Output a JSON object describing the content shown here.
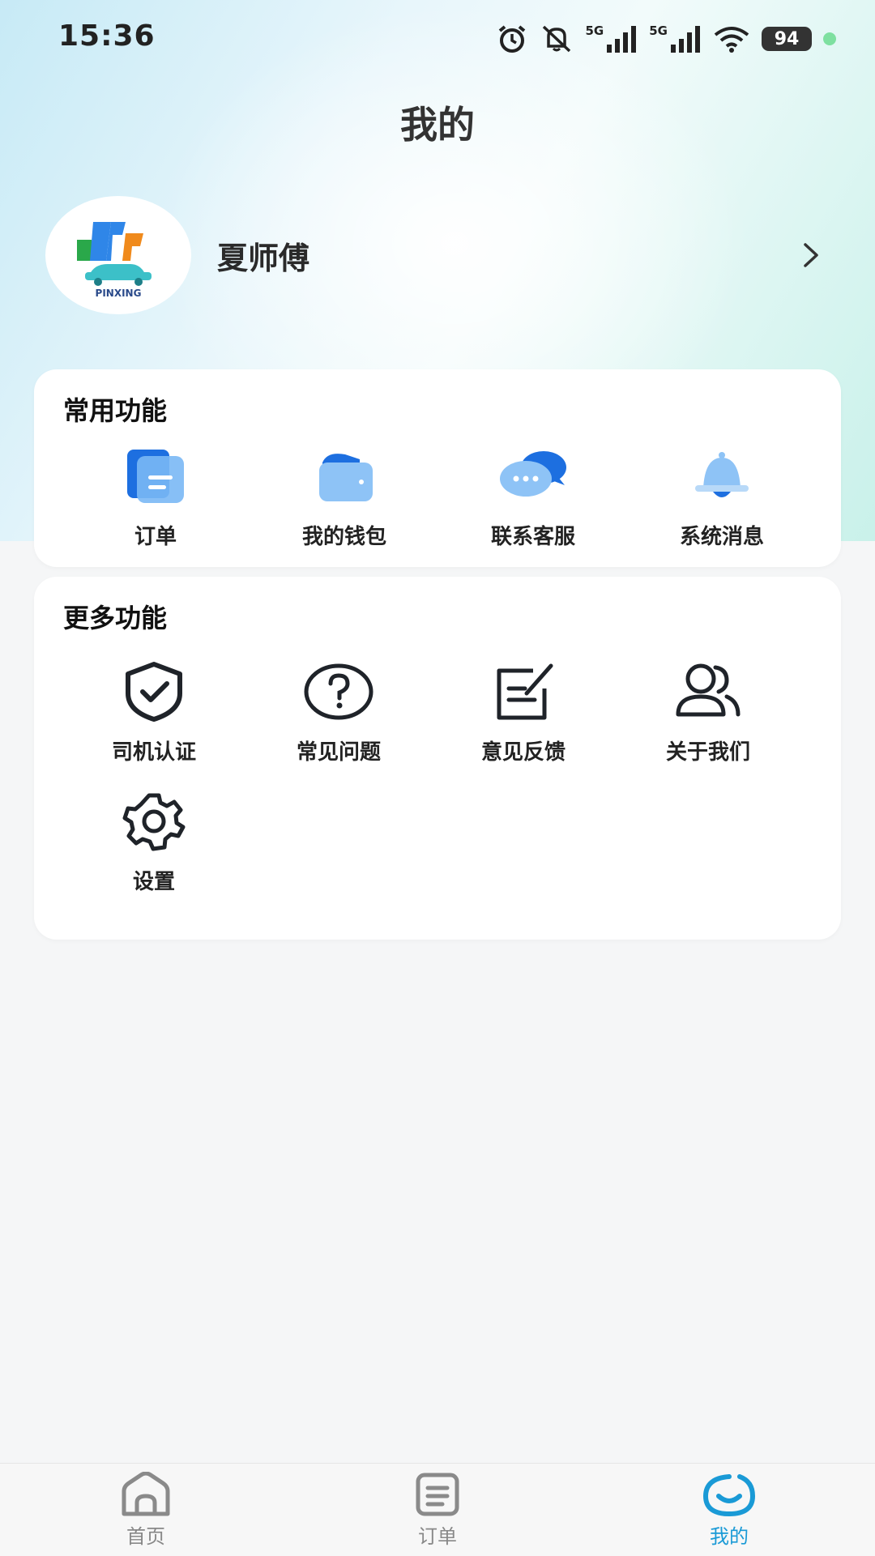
{
  "status_bar": {
    "time": "15:36",
    "network_1": "5G",
    "network_2": "5G",
    "battery": "94"
  },
  "header": {
    "title": "我的"
  },
  "profile": {
    "name": "夏师傅",
    "logo_text": "PINXING"
  },
  "common_functions": {
    "title": "常用功能",
    "items": [
      {
        "label": "订单",
        "icon": "order-doc-icon"
      },
      {
        "label": "我的钱包",
        "icon": "wallet-icon"
      },
      {
        "label": "联系客服",
        "icon": "chat-bubbles-icon"
      },
      {
        "label": "系统消息",
        "icon": "bell-icon"
      }
    ]
  },
  "more_functions": {
    "title": "更多功能",
    "items": [
      {
        "label": "司机认证",
        "icon": "shield-check-icon"
      },
      {
        "label": "常见问题",
        "icon": "question-icon"
      },
      {
        "label": "意见反馈",
        "icon": "feedback-edit-icon"
      },
      {
        "label": "关于我们",
        "icon": "users-icon"
      },
      {
        "label": "设置",
        "icon": "gear-icon"
      }
    ]
  },
  "tab_bar": {
    "tabs": [
      {
        "label": "首页",
        "icon": "home-icon",
        "active": false
      },
      {
        "label": "订单",
        "icon": "orders-icon",
        "active": false
      },
      {
        "label": "我的",
        "icon": "mine-icon",
        "active": true
      }
    ]
  },
  "colors": {
    "accent": "#1a9ad6",
    "icon_blue": "#2f86e8",
    "background": "#f5f6f7"
  }
}
